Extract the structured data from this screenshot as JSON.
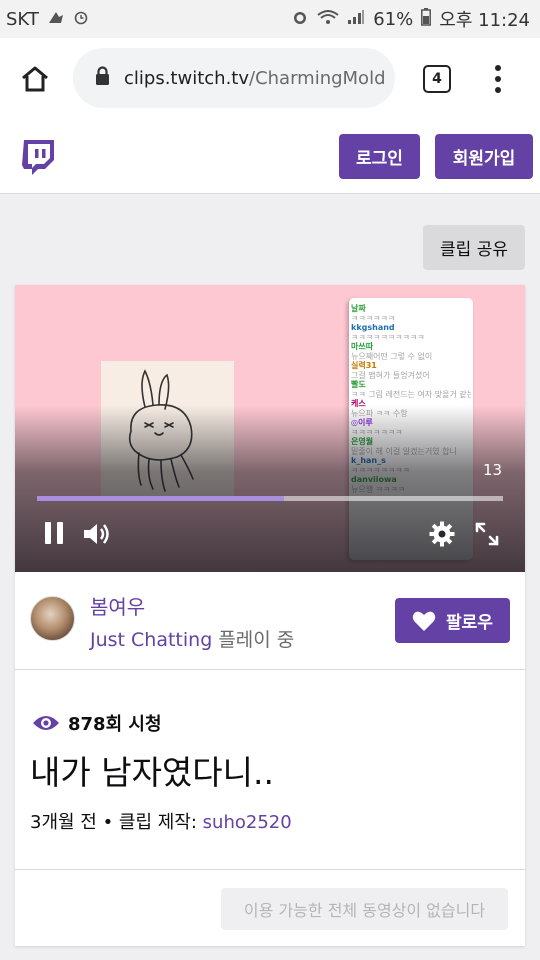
{
  "status_bar": {
    "carrier": "SKT",
    "battery": "61%",
    "time": "오후 11:24"
  },
  "browser": {
    "url_domain": "clips.twitch.tv",
    "url_path": "/CharmingMold",
    "tab_count": "4"
  },
  "header": {
    "login_label": "로그인",
    "signup_label": "회원가입"
  },
  "share_label": "클립 공유",
  "player": {
    "time_remaining": "13",
    "progress_fraction": 0.53,
    "chat_overlay": [
      {
        "name": "날짜",
        "color": "#2a9d3a",
        "text": "ㅋㅋㅋㅋㅋㅋ"
      },
      {
        "name": "kkgshand",
        "color": "#1f6fb2",
        "text": "ㅋㅋㅋㅋㅋㅋㅋㅋㅋㅋ"
      },
      {
        "name": "마쓰따",
        "color": "#2a9d3a",
        "text": "뉴으째어떤 그렇 수 없이"
      },
      {
        "name": "실력31",
        "color": "#c27a00",
        "text": "그걸 맵혀가 들엉겨셨어"
      },
      {
        "name": "빨도",
        "color": "#2a9d3a",
        "text": "ㅋㅋ 그림 레전드는 여자 맞을거 같는"
      },
      {
        "name": "케스",
        "color": "#b0006b",
        "text": "뉴으파 ㅋㅋ 수항"
      },
      {
        "name": "◎이루",
        "color": "#8a2be2",
        "text": "ㅋㅋㅋㅋㅋㅋㅋ"
      },
      {
        "name": "은영월",
        "color": "#2a9d3a",
        "text": "밑줄이 해 이걸 알겠는거였 합니"
      },
      {
        "name": "k_han_s",
        "color": "#1f6fb2",
        "text": "ㅋㅋㅋㅋㅋㅋㅋㅋ"
      },
      {
        "name": "danviiowa",
        "color": "#2a9d3a",
        "text": "뉴으챙 ㅋㅋㅋㅋ"
      }
    ]
  },
  "channel": {
    "name": "봄여우",
    "game": "Just Chatting",
    "playing_suffix": "플레이 중",
    "follow_label": "팔로우"
  },
  "clip": {
    "views": "878회 시청",
    "title": "내가 남자였다니..",
    "meta_prefix": "3개월 전 • 클립 제작: ",
    "creator": "suho2520"
  },
  "unavailable_label": "이용 가능한 전체 동영상이 없습니다",
  "colors": {
    "brand_purple": "#6441a5",
    "player_bg": "#fec8d2",
    "progress": "#a98ee0"
  },
  "icons": [
    "home-icon",
    "lock-icon",
    "tabs-icon",
    "menu-icon",
    "twitch-logo",
    "pause-icon",
    "volume-icon",
    "gear-icon",
    "fullscreen-icon",
    "heart-icon",
    "eye-icon"
  ]
}
